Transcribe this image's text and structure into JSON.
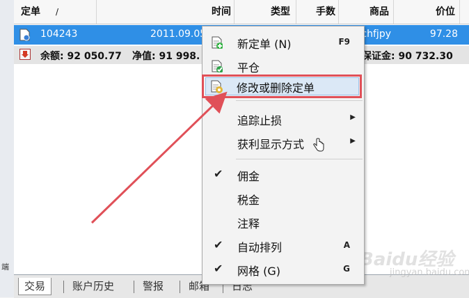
{
  "header": {
    "col_order": "定单",
    "sort_indicator": "/",
    "col_time": "时间",
    "col_type": "类型",
    "col_lots": "手数",
    "col_symbol": "商品",
    "col_price": "价位"
  },
  "order_row": {
    "ticket": "104243",
    "time": "2011.09.05",
    "symbol": "chfjpy",
    "price": "97.28"
  },
  "summary_row": {
    "balance": "余额: 92 050.77",
    "equity": "净值: 91 998.",
    "margin": "保证金: 90 732.30"
  },
  "sidebar": {
    "label": "端"
  },
  "tabs": [
    "交易",
    "账户历史",
    "警报",
    "邮箱",
    "日志"
  ],
  "context_menu": {
    "new_order": {
      "label": "新定单 (N)",
      "shortcut": "F9"
    },
    "close": {
      "label": "平仓"
    },
    "modify_delete": {
      "label": "修改或删除定单"
    },
    "trailing_stop": {
      "label": "追踪止损"
    },
    "profit_display": {
      "label": "获利显示方式"
    },
    "commission": {
      "label": "佣金",
      "checked": true
    },
    "taxes": {
      "label": "税金",
      "checked": false
    },
    "comments": {
      "label": "注释",
      "checked": false
    },
    "auto_arrange": {
      "label": "自动排列",
      "shortcut": "A",
      "checked": true
    },
    "grid": {
      "label": "网格 (G)",
      "shortcut": "G",
      "checked": true
    }
  },
  "watermark": {
    "text": "Baidu经验",
    "sub": "jingyan.baidu.com"
  },
  "colors": {
    "selection": "#2f8fe6",
    "highlight_box": "#e05058",
    "arrow": "#e05058"
  }
}
